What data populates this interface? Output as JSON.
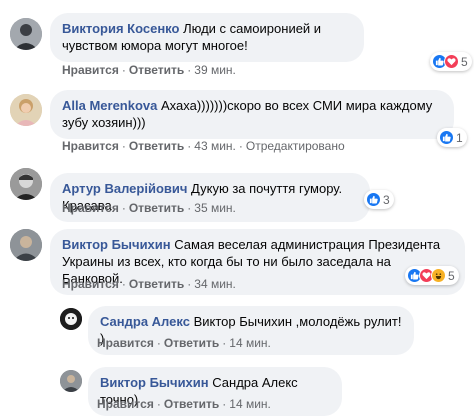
{
  "comments": [
    {
      "author": "Виктория Косенко",
      "text": "Люди с самоиронией и чувством юмора могут многое!",
      "like": "Нравится",
      "reply": "Ответить",
      "time": "39 мин.",
      "reactions": "5"
    },
    {
      "author": "Alla Merenkova",
      "text": "Ахаха)))))))скоро во всех СМИ мира каждому зубу хозяин)))",
      "like": "Нравится",
      "reply": "Ответить",
      "time": "43 мин.",
      "edited": "Отредактировано",
      "reactions": "1"
    },
    {
      "author": "Артур Валерійович",
      "text": "Дукую за почуття гумору. Красава",
      "like": "Нравится",
      "reply": "Ответить",
      "time": "35 мин.",
      "reactions": "3"
    },
    {
      "author": "Виктор Бычихин",
      "text": "Самая веселая администрация Президента Украины из всех, кто когда бы то ни было заседала на Банковой.",
      "like": "Нравится",
      "reply": "Ответить",
      "time": "34 мин.",
      "reactions": "5"
    },
    {
      "author": "Сандра Алекс",
      "text": "Виктор Бычихин ,молодёжь рулит! )",
      "like": "Нравится",
      "reply": "Ответить",
      "time": "14 мин."
    },
    {
      "author": "Виктор Бычихин",
      "text": "Сандра Алекс точно)",
      "like": "Нравится",
      "reply": "Ответить",
      "time": "14 мин."
    }
  ],
  "colors": {
    "author": "#385898",
    "bubble": "#f0f2f5",
    "meta": "#65676b",
    "like": "#1877f2",
    "love": "#f33e58",
    "haha": "#f7b125"
  }
}
